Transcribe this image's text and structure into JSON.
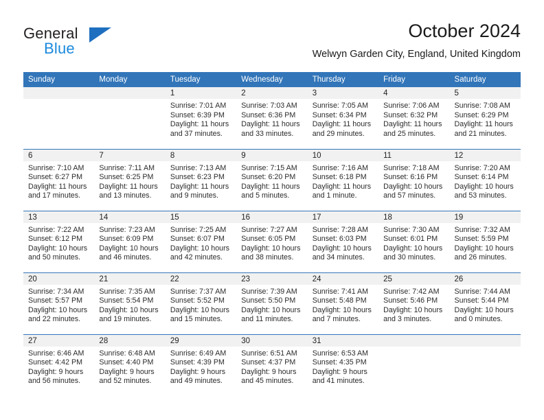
{
  "brand": {
    "name_part1": "General",
    "name_part2": "Blue",
    "accent_dark": "#1f6fc0",
    "accent_light": "#1a89dc"
  },
  "header": {
    "title": "October 2024",
    "subtitle": "Welwyn Garden City, England, United Kingdom"
  },
  "theme": {
    "header_bar": "#3275b9",
    "daynum_band": "#f1f1f1",
    "row_divider": "#3275b9"
  },
  "weekday_headers": [
    "Sunday",
    "Monday",
    "Tuesday",
    "Wednesday",
    "Thursday",
    "Friday",
    "Saturday"
  ],
  "weeks": [
    [
      {
        "day": "",
        "sunrise": "",
        "sunset": "",
        "daylight1": "",
        "daylight2": ""
      },
      {
        "day": "",
        "sunrise": "",
        "sunset": "",
        "daylight1": "",
        "daylight2": ""
      },
      {
        "day": "1",
        "sunrise": "Sunrise: 7:01 AM",
        "sunset": "Sunset: 6:39 PM",
        "daylight1": "Daylight: 11 hours",
        "daylight2": "and 37 minutes."
      },
      {
        "day": "2",
        "sunrise": "Sunrise: 7:03 AM",
        "sunset": "Sunset: 6:36 PM",
        "daylight1": "Daylight: 11 hours",
        "daylight2": "and 33 minutes."
      },
      {
        "day": "3",
        "sunrise": "Sunrise: 7:05 AM",
        "sunset": "Sunset: 6:34 PM",
        "daylight1": "Daylight: 11 hours",
        "daylight2": "and 29 minutes."
      },
      {
        "day": "4",
        "sunrise": "Sunrise: 7:06 AM",
        "sunset": "Sunset: 6:32 PM",
        "daylight1": "Daylight: 11 hours",
        "daylight2": "and 25 minutes."
      },
      {
        "day": "5",
        "sunrise": "Sunrise: 7:08 AM",
        "sunset": "Sunset: 6:29 PM",
        "daylight1": "Daylight: 11 hours",
        "daylight2": "and 21 minutes."
      }
    ],
    [
      {
        "day": "6",
        "sunrise": "Sunrise: 7:10 AM",
        "sunset": "Sunset: 6:27 PM",
        "daylight1": "Daylight: 11 hours",
        "daylight2": "and 17 minutes."
      },
      {
        "day": "7",
        "sunrise": "Sunrise: 7:11 AM",
        "sunset": "Sunset: 6:25 PM",
        "daylight1": "Daylight: 11 hours",
        "daylight2": "and 13 minutes."
      },
      {
        "day": "8",
        "sunrise": "Sunrise: 7:13 AM",
        "sunset": "Sunset: 6:23 PM",
        "daylight1": "Daylight: 11 hours",
        "daylight2": "and 9 minutes."
      },
      {
        "day": "9",
        "sunrise": "Sunrise: 7:15 AM",
        "sunset": "Sunset: 6:20 PM",
        "daylight1": "Daylight: 11 hours",
        "daylight2": "and 5 minutes."
      },
      {
        "day": "10",
        "sunrise": "Sunrise: 7:16 AM",
        "sunset": "Sunset: 6:18 PM",
        "daylight1": "Daylight: 11 hours",
        "daylight2": "and 1 minute."
      },
      {
        "day": "11",
        "sunrise": "Sunrise: 7:18 AM",
        "sunset": "Sunset: 6:16 PM",
        "daylight1": "Daylight: 10 hours",
        "daylight2": "and 57 minutes."
      },
      {
        "day": "12",
        "sunrise": "Sunrise: 7:20 AM",
        "sunset": "Sunset: 6:14 PM",
        "daylight1": "Daylight: 10 hours",
        "daylight2": "and 53 minutes."
      }
    ],
    [
      {
        "day": "13",
        "sunrise": "Sunrise: 7:22 AM",
        "sunset": "Sunset: 6:12 PM",
        "daylight1": "Daylight: 10 hours",
        "daylight2": "and 50 minutes."
      },
      {
        "day": "14",
        "sunrise": "Sunrise: 7:23 AM",
        "sunset": "Sunset: 6:09 PM",
        "daylight1": "Daylight: 10 hours",
        "daylight2": "and 46 minutes."
      },
      {
        "day": "15",
        "sunrise": "Sunrise: 7:25 AM",
        "sunset": "Sunset: 6:07 PM",
        "daylight1": "Daylight: 10 hours",
        "daylight2": "and 42 minutes."
      },
      {
        "day": "16",
        "sunrise": "Sunrise: 7:27 AM",
        "sunset": "Sunset: 6:05 PM",
        "daylight1": "Daylight: 10 hours",
        "daylight2": "and 38 minutes."
      },
      {
        "day": "17",
        "sunrise": "Sunrise: 7:28 AM",
        "sunset": "Sunset: 6:03 PM",
        "daylight1": "Daylight: 10 hours",
        "daylight2": "and 34 minutes."
      },
      {
        "day": "18",
        "sunrise": "Sunrise: 7:30 AM",
        "sunset": "Sunset: 6:01 PM",
        "daylight1": "Daylight: 10 hours",
        "daylight2": "and 30 minutes."
      },
      {
        "day": "19",
        "sunrise": "Sunrise: 7:32 AM",
        "sunset": "Sunset: 5:59 PM",
        "daylight1": "Daylight: 10 hours",
        "daylight2": "and 26 minutes."
      }
    ],
    [
      {
        "day": "20",
        "sunrise": "Sunrise: 7:34 AM",
        "sunset": "Sunset: 5:57 PM",
        "daylight1": "Daylight: 10 hours",
        "daylight2": "and 22 minutes."
      },
      {
        "day": "21",
        "sunrise": "Sunrise: 7:35 AM",
        "sunset": "Sunset: 5:54 PM",
        "daylight1": "Daylight: 10 hours",
        "daylight2": "and 19 minutes."
      },
      {
        "day": "22",
        "sunrise": "Sunrise: 7:37 AM",
        "sunset": "Sunset: 5:52 PM",
        "daylight1": "Daylight: 10 hours",
        "daylight2": "and 15 minutes."
      },
      {
        "day": "23",
        "sunrise": "Sunrise: 7:39 AM",
        "sunset": "Sunset: 5:50 PM",
        "daylight1": "Daylight: 10 hours",
        "daylight2": "and 11 minutes."
      },
      {
        "day": "24",
        "sunrise": "Sunrise: 7:41 AM",
        "sunset": "Sunset: 5:48 PM",
        "daylight1": "Daylight: 10 hours",
        "daylight2": "and 7 minutes."
      },
      {
        "day": "25",
        "sunrise": "Sunrise: 7:42 AM",
        "sunset": "Sunset: 5:46 PM",
        "daylight1": "Daylight: 10 hours",
        "daylight2": "and 3 minutes."
      },
      {
        "day": "26",
        "sunrise": "Sunrise: 7:44 AM",
        "sunset": "Sunset: 5:44 PM",
        "daylight1": "Daylight: 10 hours",
        "daylight2": "and 0 minutes."
      }
    ],
    [
      {
        "day": "27",
        "sunrise": "Sunrise: 6:46 AM",
        "sunset": "Sunset: 4:42 PM",
        "daylight1": "Daylight: 9 hours",
        "daylight2": "and 56 minutes."
      },
      {
        "day": "28",
        "sunrise": "Sunrise: 6:48 AM",
        "sunset": "Sunset: 4:40 PM",
        "daylight1": "Daylight: 9 hours",
        "daylight2": "and 52 minutes."
      },
      {
        "day": "29",
        "sunrise": "Sunrise: 6:49 AM",
        "sunset": "Sunset: 4:39 PM",
        "daylight1": "Daylight: 9 hours",
        "daylight2": "and 49 minutes."
      },
      {
        "day": "30",
        "sunrise": "Sunrise: 6:51 AM",
        "sunset": "Sunset: 4:37 PM",
        "daylight1": "Daylight: 9 hours",
        "daylight2": "and 45 minutes."
      },
      {
        "day": "31",
        "sunrise": "Sunrise: 6:53 AM",
        "sunset": "Sunset: 4:35 PM",
        "daylight1": "Daylight: 9 hours",
        "daylight2": "and 41 minutes."
      },
      {
        "day": "",
        "sunrise": "",
        "sunset": "",
        "daylight1": "",
        "daylight2": ""
      },
      {
        "day": "",
        "sunrise": "",
        "sunset": "",
        "daylight1": "",
        "daylight2": ""
      }
    ]
  ]
}
